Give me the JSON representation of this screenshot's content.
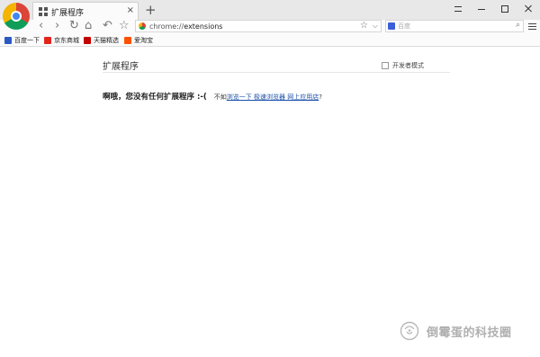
{
  "tab": {
    "title": "扩展程序",
    "close": "×"
  },
  "new_tab": "+",
  "toolbar": {
    "back": "‹",
    "forward": "›",
    "reload": "↻",
    "home": "⌂",
    "undo": "↶",
    "star": "☆",
    "omnibox": {
      "scheme": "chrome://",
      "path": "extensions",
      "star": "☆",
      "dropdown": "⌵"
    },
    "search": {
      "placeholder": "百度",
      "button": "⌕"
    }
  },
  "bookmarks": [
    {
      "label": "百度一下",
      "color": "#2b59c3"
    },
    {
      "label": "京东商城",
      "color": "#e1251b"
    },
    {
      "label": "天猫精选",
      "color": "#c40000"
    },
    {
      "label": "爱淘宝",
      "color": "#ff5000"
    }
  ],
  "page": {
    "title": "扩展程序",
    "dev_mode_label": "开发者模式",
    "empty_message": "啊哦，您没有任何扩展程序 :-(",
    "empty_prefix": "不如",
    "empty_link": "浏览一下 极速浏览器 网上应用店",
    "empty_suffix": "?"
  },
  "watermark": {
    "text": "倒霉蛋的科技圈"
  }
}
